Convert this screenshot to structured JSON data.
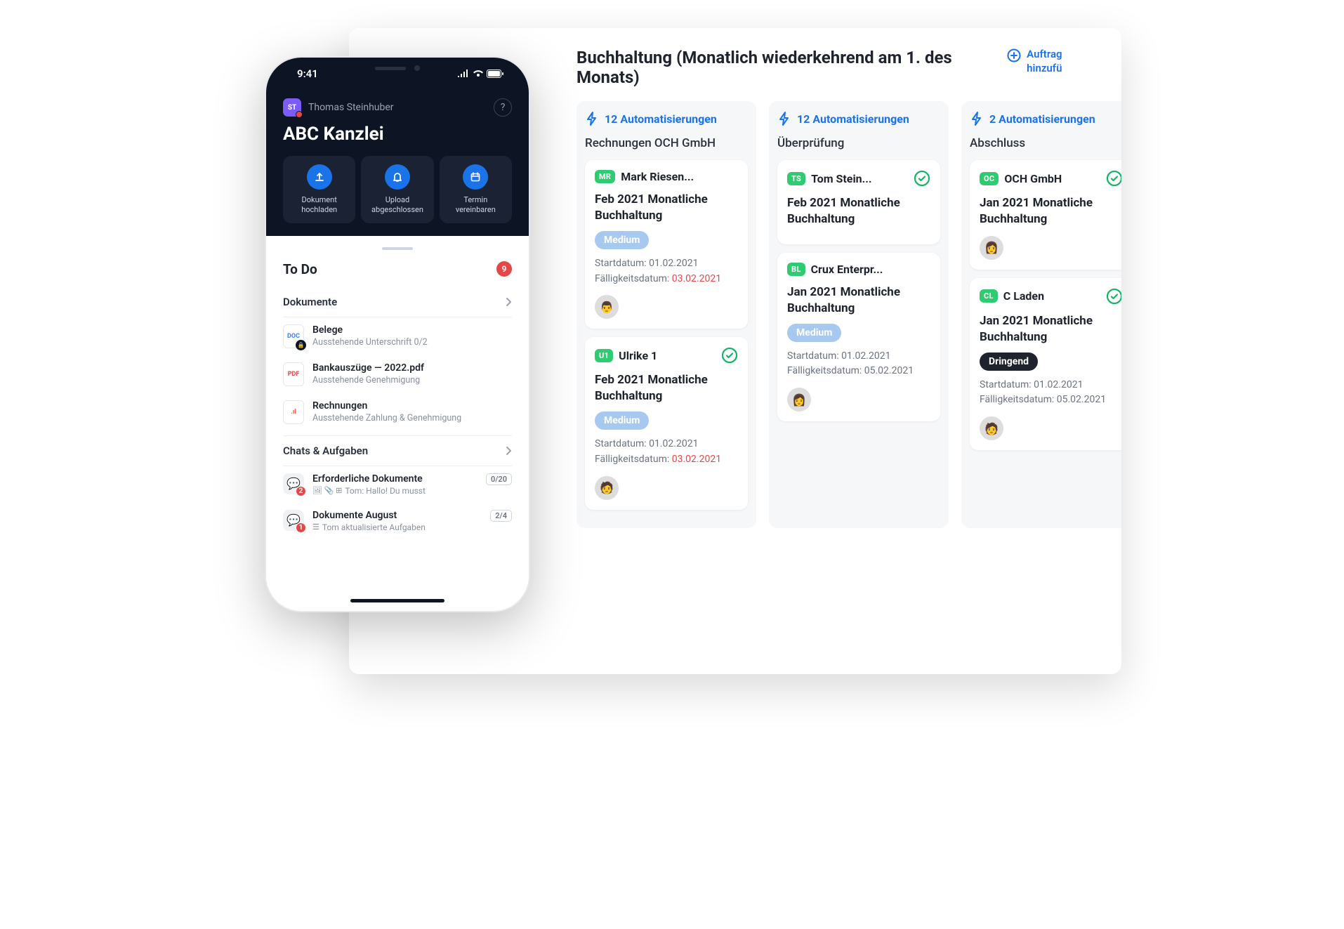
{
  "board": {
    "title": "Buchhaltung (Monatlich wiederkehrend am 1. des Monats)",
    "addJobLabel": "Auftrag hinzufü"
  },
  "columns": [
    {
      "autoCount": 12,
      "autoLabel": "Automatisierungen",
      "title": "Rechnungen OCH GmbH"
    },
    {
      "autoCount": 12,
      "autoLabel": "Automatisierungen",
      "title": "Überprüfung"
    },
    {
      "autoCount": 2,
      "autoLabel": "Automatisierungen",
      "title": "Abschluss"
    }
  ],
  "cards": {
    "c0": [
      {
        "initials": "MR",
        "badgeColor": "#2ecc71",
        "name": "Mark Riesen...",
        "checked": false,
        "title": "Feb 2021 Monatliche Buchhaltung",
        "priority": "Medium",
        "priorityType": "medium",
        "startLabel": "Startdatum:",
        "start": "01.02.2021",
        "dueLabel": "Fälligkeitsdatum:",
        "due": "03.02.2021",
        "dueRed": true,
        "avatar": "👨"
      },
      {
        "initials": "U1",
        "badgeColor": "#2ecc71",
        "name": "Ulrike 1",
        "checked": true,
        "title": "Feb 2021 Monatliche Buchhaltung",
        "priority": "Medium",
        "priorityType": "medium",
        "startLabel": "Startdatum:",
        "start": "01.02.2021",
        "dueLabel": "Fälligkeitsdatum:",
        "due": "03.02.2021",
        "dueRed": true,
        "avatar": "🧑"
      }
    ],
    "c1": [
      {
        "initials": "TS",
        "badgeColor": "#2ecc71",
        "name": "Tom Stein...",
        "checked": true,
        "title": "Feb 2021 Monatliche Buchhaltung"
      },
      {
        "initials": "BL",
        "badgeColor": "#2ecc71",
        "name": "Crux Enterpr...",
        "checked": false,
        "title": "Jan 2021 Monatliche Buchhaltung",
        "priority": "Medium",
        "priorityType": "medium",
        "startLabel": "Startdatum:",
        "start": "01.02.2021",
        "dueLabel": "Fälligkeitsdatum:",
        "due": "05.02.2021",
        "dueRed": false,
        "avatar": "👩"
      }
    ],
    "c2": [
      {
        "initials": "OC",
        "badgeColor": "#2ecc71",
        "name": "OCH GmbH",
        "checked": true,
        "title": "Jan 2021 Monatliche Buchhaltung",
        "avatar": "👩"
      },
      {
        "initials": "CL",
        "badgeColor": "#2ecc71",
        "name": "C Laden",
        "checked": true,
        "title": "Jan 2021 Monatliche Buchhaltung",
        "priority": "Dringend",
        "priorityType": "urgent",
        "startLabel": "Startdatum:",
        "start": "01.02.2021",
        "dueLabel": "Fälligkeitsdatum:",
        "due": "05.02.2021",
        "dueRed": false,
        "avatar": "🧑"
      }
    ]
  },
  "phone": {
    "time": "9:41",
    "userInitials": "ST",
    "userName": "Thomas Steinhuber",
    "orgName": "ABC Kanzlei",
    "actions": [
      {
        "label": "Dokument hochladen"
      },
      {
        "label": "Upload abgeschlossen"
      },
      {
        "label": "Termin vereinbaren"
      }
    ],
    "todoTitle": "To Do",
    "todoCount": 9,
    "docsTitle": "Dokumente",
    "docs": [
      {
        "type": "doc",
        "title": "Belege",
        "sub": "Ausstehende Unterschrift 0/2",
        "locked": true
      },
      {
        "type": "pdf",
        "title": "Bankauszüge — 2022.pdf",
        "sub": "Ausstehende Genehmigung",
        "locked": false
      },
      {
        "type": "ppt",
        "title": "Rechnungen",
        "sub": "Ausstehende Zahlung & Genehmigung",
        "locked": false
      }
    ],
    "chatsTitle": "Chats & Aufgaben",
    "chats": [
      {
        "title": "Erforderliche Dokumente",
        "sub": "Tom: Hallo! Du musst",
        "count": "0/20",
        "badge": 2
      },
      {
        "title": "Dokumente August",
        "sub": "Tom aktualisierte Aufgaben",
        "count": "2/4",
        "badge": 1
      }
    ]
  }
}
